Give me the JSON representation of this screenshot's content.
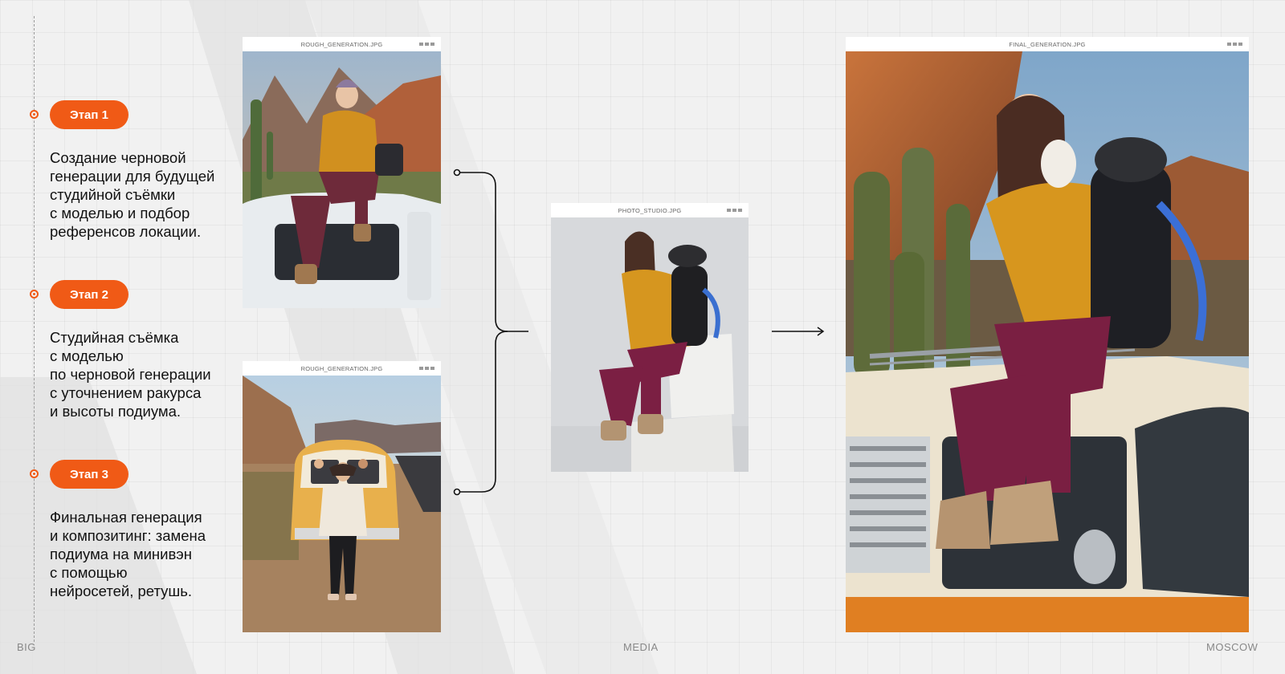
{
  "colors": {
    "accent": "#f05a16",
    "background": "#f1f1f1"
  },
  "stages": [
    {
      "label": "Этап 1",
      "description": "Создание черновой\nгенерации для будущей\nстудийной съёмки\nс моделью и подбор\nреференсов локации."
    },
    {
      "label": "Этап 2",
      "description": "Студийная съёмка\nс моделью\nпо черновой генерации\nс уточнением ракурса\nи высоты подиума."
    },
    {
      "label": "Этап 3",
      "description": "Финальная генерация\nи композитинг: замена\nподиума на минивэн\nс помощью\nнейросетей, ретушь."
    }
  ],
  "windows": {
    "rough1": {
      "title": "ROUGH_GENERATION.JPG",
      "image": "woman-sitting-on-van-roof-desert-photo"
    },
    "rough2": {
      "title": "ROUGH_GENERATION.JPG",
      "image": "woman-standing-by-orange-van-desert-road-photo"
    },
    "studio": {
      "title": "PHOTO_STUDIO.JPG",
      "image": "model-sitting-on-studio-podium-photo"
    },
    "final": {
      "title": "FINAL_GENERATION.JPG",
      "image": "model-sitting-on-van-roof-cactus-canyon-photo"
    }
  },
  "footer": {
    "left": "BIG",
    "center": "MEDIA",
    "right": "MOSCOW"
  }
}
